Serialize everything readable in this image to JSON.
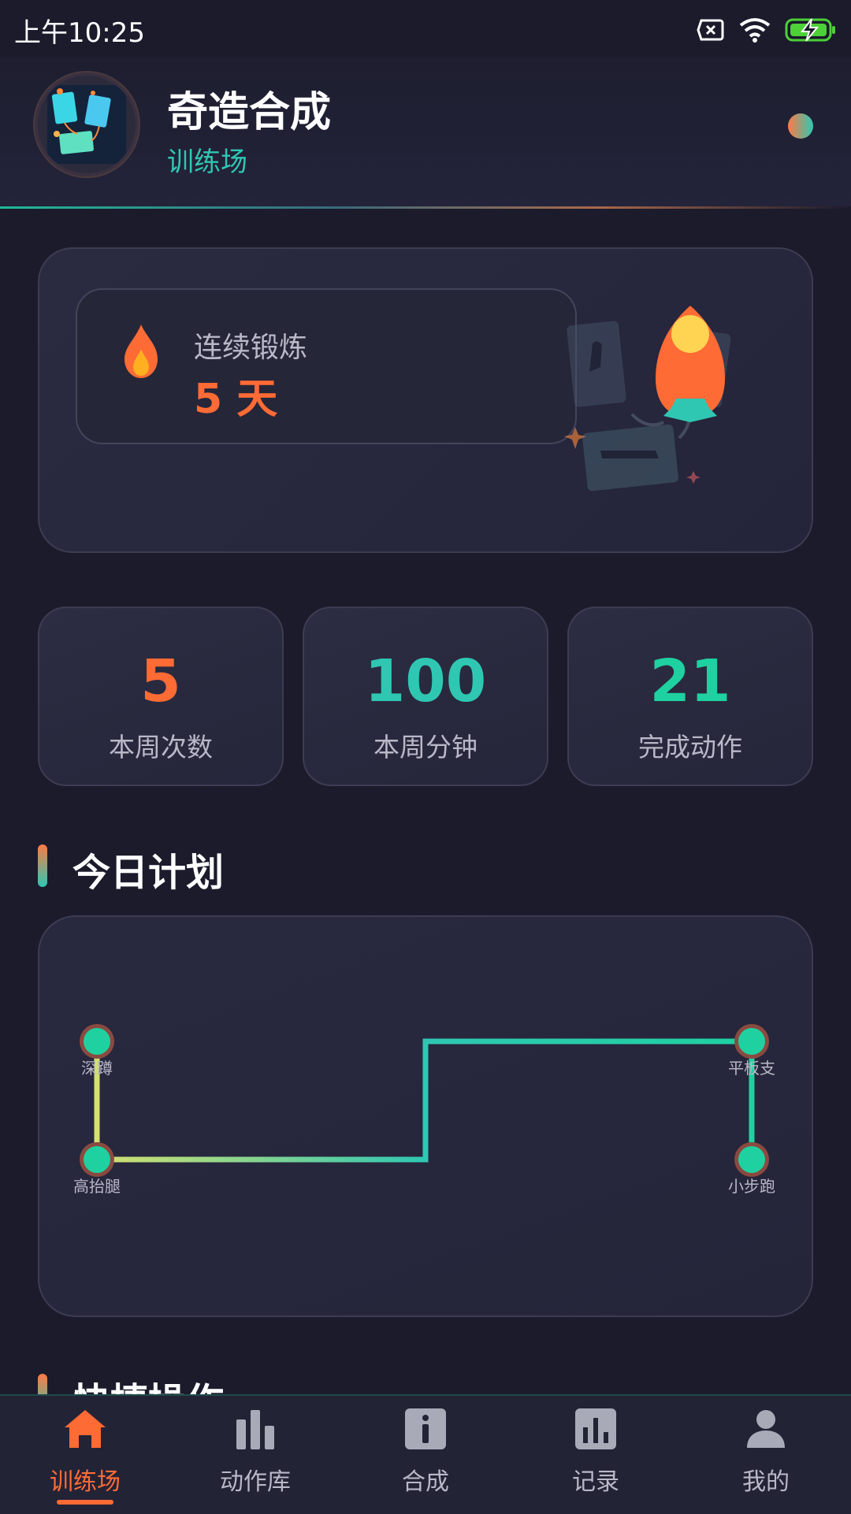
{
  "status_bar": {
    "time": "上午10:25"
  },
  "header": {
    "title": "奇造合成",
    "subtitle": "训练场"
  },
  "streak": {
    "label": "连续锻炼",
    "value": "5 天"
  },
  "stats": [
    {
      "value": "5",
      "label": "本周次数",
      "color": "#ff6b35"
    },
    {
      "value": "100",
      "label": "本周分钟",
      "color": "#2fc7b2"
    },
    {
      "value": "21",
      "label": "完成动作",
      "color": "#1fd1a0"
    }
  ],
  "today_plan": {
    "title": "今日计划",
    "nodes": [
      "深蹲",
      "高抬腿",
      "平板支",
      "小步跑"
    ]
  },
  "quick_actions": {
    "title": "快捷操作"
  },
  "bottom_nav": {
    "items": [
      {
        "label": "训练场",
        "icon": "home-icon",
        "active": true
      },
      {
        "label": "动作库",
        "icon": "bar-chart-icon",
        "active": false
      },
      {
        "label": "合成",
        "icon": "info-icon",
        "active": false
      },
      {
        "label": "记录",
        "icon": "stats-icon",
        "active": false
      },
      {
        "label": "我的",
        "icon": "user-icon",
        "active": false
      }
    ]
  },
  "colors": {
    "accent": "#ff6b35",
    "teal": "#2fc7b2",
    "background": "#1b1b2c"
  }
}
